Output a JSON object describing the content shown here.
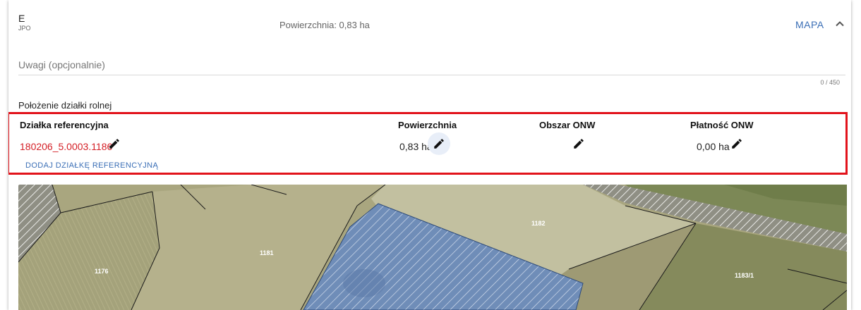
{
  "header": {
    "code": "E",
    "subcode": "JPO",
    "area_text": "Powierzchnia: 0,83 ha",
    "map_link": "MAPA"
  },
  "remarks": {
    "placeholder": "Uwagi (opcjonalnie)",
    "value": "",
    "counter": "0 / 450"
  },
  "location": {
    "title": "Położenie działki rolnej",
    "columns": {
      "parcel": "Działka referencyjna",
      "area": "Powierzchnia",
      "onw_zone": "Obszar ONW",
      "onw_payment": "Płatność ONW"
    },
    "row": {
      "parcel_id": "180206_5.0003.1186",
      "area": "0,83 ha",
      "onw_payment": "0,00 ha"
    },
    "add_parcel": "DODAJ DZIAŁKĘ REFERENCYJNĄ"
  },
  "map": {
    "plots": [
      "1176",
      "1181",
      "1182",
      "1183/1"
    ]
  },
  "colors": {
    "accent": "#3b6fb6",
    "highlight": "#e2131b",
    "parcel_link": "#d41f26"
  },
  "icons": [
    "chevron-up-icon",
    "pencil-icon"
  ]
}
